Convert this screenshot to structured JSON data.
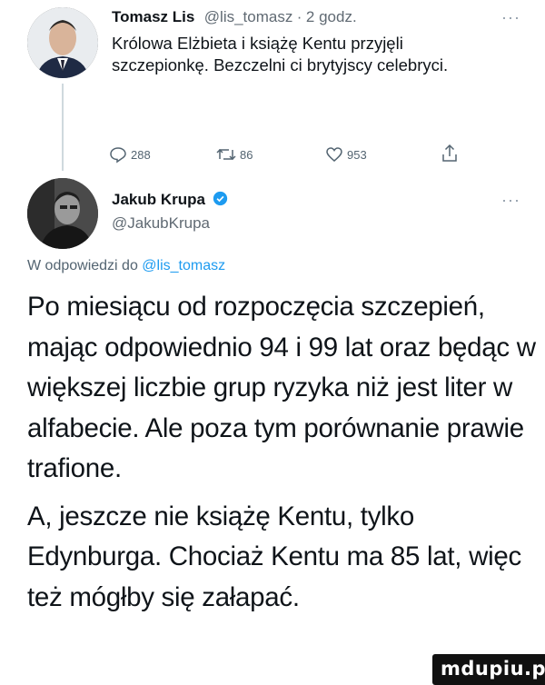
{
  "tweet1": {
    "author_name": "Tomasz Lis",
    "author_handle": "@lis_tomasz",
    "separator": "·",
    "time": "2 godz.",
    "more": "···",
    "text": "Królowa Elżbieta i książę Kentu  przyjęli szczepionkę. Bezczelni ci brytyjscy celebryci.",
    "actions": {
      "reply_count": "288",
      "retweet_count": "86",
      "like_count": "953"
    }
  },
  "tweet2": {
    "author_name": "Jakub Krupa",
    "author_handle": "@JakubKrupa",
    "more": "···",
    "reply_to_prefix": "W odpowiedzi do",
    "reply_to_handle": "@lis_tomasz",
    "paragraph1": "Po miesiącu od rozpoczęcia szczepień, mając odpowiednio 94 i 99 lat oraz będąc w większej liczbie grup ryzyka niż jest liter w alfabecie. Ale poza tym porównanie prawie trafione.",
    "paragraph2": "A, jeszcze nie książę Kentu, tylko Edynburga. Chociaż Kentu ma 85 lat, więc też mógłby się załapać."
  },
  "colors": {
    "accent": "#1d9bf0",
    "text": "#0f1419",
    "secondary": "#536471"
  },
  "watermark": "mdupiu.pl"
}
